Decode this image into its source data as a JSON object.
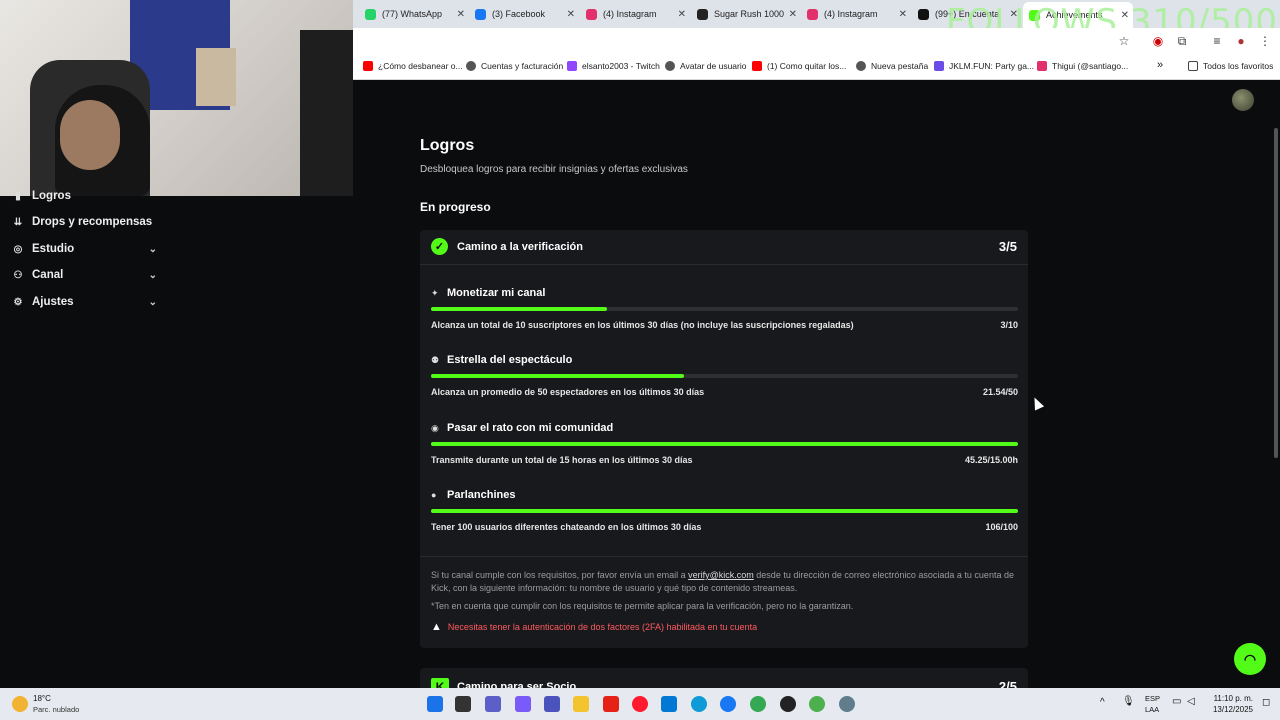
{
  "browser": {
    "tabs": [
      {
        "label": "(77) WhatsApp",
        "color": "#25d366"
      },
      {
        "label": "(3) Facebook",
        "color": "#1877f2"
      },
      {
        "label": "(4) Instagram",
        "color": "#e1306c"
      },
      {
        "label": "Sugar Rush 1000",
        "color": "#222222"
      },
      {
        "label": "(4) Instagram",
        "color": "#e1306c"
      },
      {
        "label": "(99+) En cuenta",
        "color": "#111111"
      },
      {
        "label": "Achievements",
        "color": "#53fc18",
        "active": true
      }
    ],
    "overlay_text": "FOLLOWS 310/500",
    "bookmarks": [
      {
        "label": "¿Cómo desbanear o...",
        "color": "#ff0000"
      },
      {
        "label": "Cuentas y facturación",
        "color": "#555555"
      },
      {
        "label": "elsanto2003 - Twitch",
        "color": "#9146ff"
      },
      {
        "label": "Avatar de usuario",
        "color": "#555555"
      },
      {
        "label": "(1) Como quitar los...",
        "color": "#ff0000"
      },
      {
        "label": "Nueva pestaña",
        "color": "#555555"
      },
      {
        "label": "JKLM.FUN: Party ga...",
        "color": "#6b4ce6"
      },
      {
        "label": "Thigui (@santiago...",
        "color": "#e1306c"
      }
    ],
    "bookmarks_more": "»",
    "all_bookmarks": "Todos los favoritos"
  },
  "sidebar": {
    "items": [
      {
        "label": "Logros",
        "icon": "trophy-icon",
        "glyph": "▮"
      },
      {
        "label": "Drops y recompensas",
        "icon": "drops-icon",
        "glyph": "⇊"
      },
      {
        "label": "Estudio",
        "icon": "studio-icon",
        "glyph": "◎",
        "chevron": "⌄"
      },
      {
        "label": "Canal",
        "icon": "channel-icon",
        "glyph": "⚇",
        "chevron": "⌄"
      },
      {
        "label": "Ajustes",
        "icon": "settings-icon",
        "glyph": "⚙",
        "chevron": "⌄"
      }
    ]
  },
  "main": {
    "title": "Logros",
    "subtitle": "Desbloquea logros para recibir insignias y ofertas exclusivas",
    "section_title": "En progreso",
    "card1": {
      "title": "Camino a la verificación",
      "count": "3/5",
      "achievements": [
        {
          "title": "Monetizar mi canal",
          "icon": "sparkle-icon",
          "glyph": "✦",
          "description": "Alcanza un total de 10 suscriptores en los últimos 30 días (no incluye las suscripciones regaladas)",
          "progress": "3/10",
          "fraction": 0.3
        },
        {
          "title": "Estrella del espectáculo",
          "icon": "viewers-icon",
          "glyph": "⚉",
          "description": "Alcanza un promedio de 50 espectadores en los últimos 30 días",
          "progress": "21.54/50",
          "fraction": 0.4308
        },
        {
          "title": "Pasar el rato con mi comunidad",
          "icon": "broadcast-icon",
          "glyph": "◉",
          "description": "Transmite durante un total de 15 horas en los últimos 30 días",
          "progress": "45.25/15.00h",
          "fraction": 1.0
        },
        {
          "title": "Parlanchines",
          "icon": "chat-bubble-icon",
          "glyph": "●",
          "description": "Tener 100 usuarios diferentes chateando en los últimos 30 días",
          "progress": "106/100",
          "fraction": 1.0
        }
      ],
      "note_prefix": "Si tu canal cumple con los requisitos, por favor envía un email a ",
      "note_email": "verify@kick.com",
      "note_suffix": " desde tu dirección de correo electrónico asociada a tu cuenta de Kick, con la siguiente información: tu nombre de usuario y qué tipo de contenido streameas.",
      "disclaimer": "*Ten en cuenta que cumplir con los requisitos te permite aplicar para la verificación, pero no la garantizan.",
      "warning": "Necesitas tener la autenticación de dos factores (2FA) habilitada en tu cuenta"
    },
    "card2": {
      "title": "Camino para ser Socio",
      "count": "2/5"
    }
  },
  "taskbar": {
    "weather_temp": "18°C",
    "weather_desc": "Parc. nublado",
    "lang_line1": "ESP",
    "lang_line2": "LAA",
    "time": "11:10 p. m.",
    "date": "13/12/2025"
  },
  "colors": {
    "accent": "#53fc18",
    "warning": "#ff5a5f",
    "background": "#0b0c0e",
    "card": "#18191c"
  }
}
